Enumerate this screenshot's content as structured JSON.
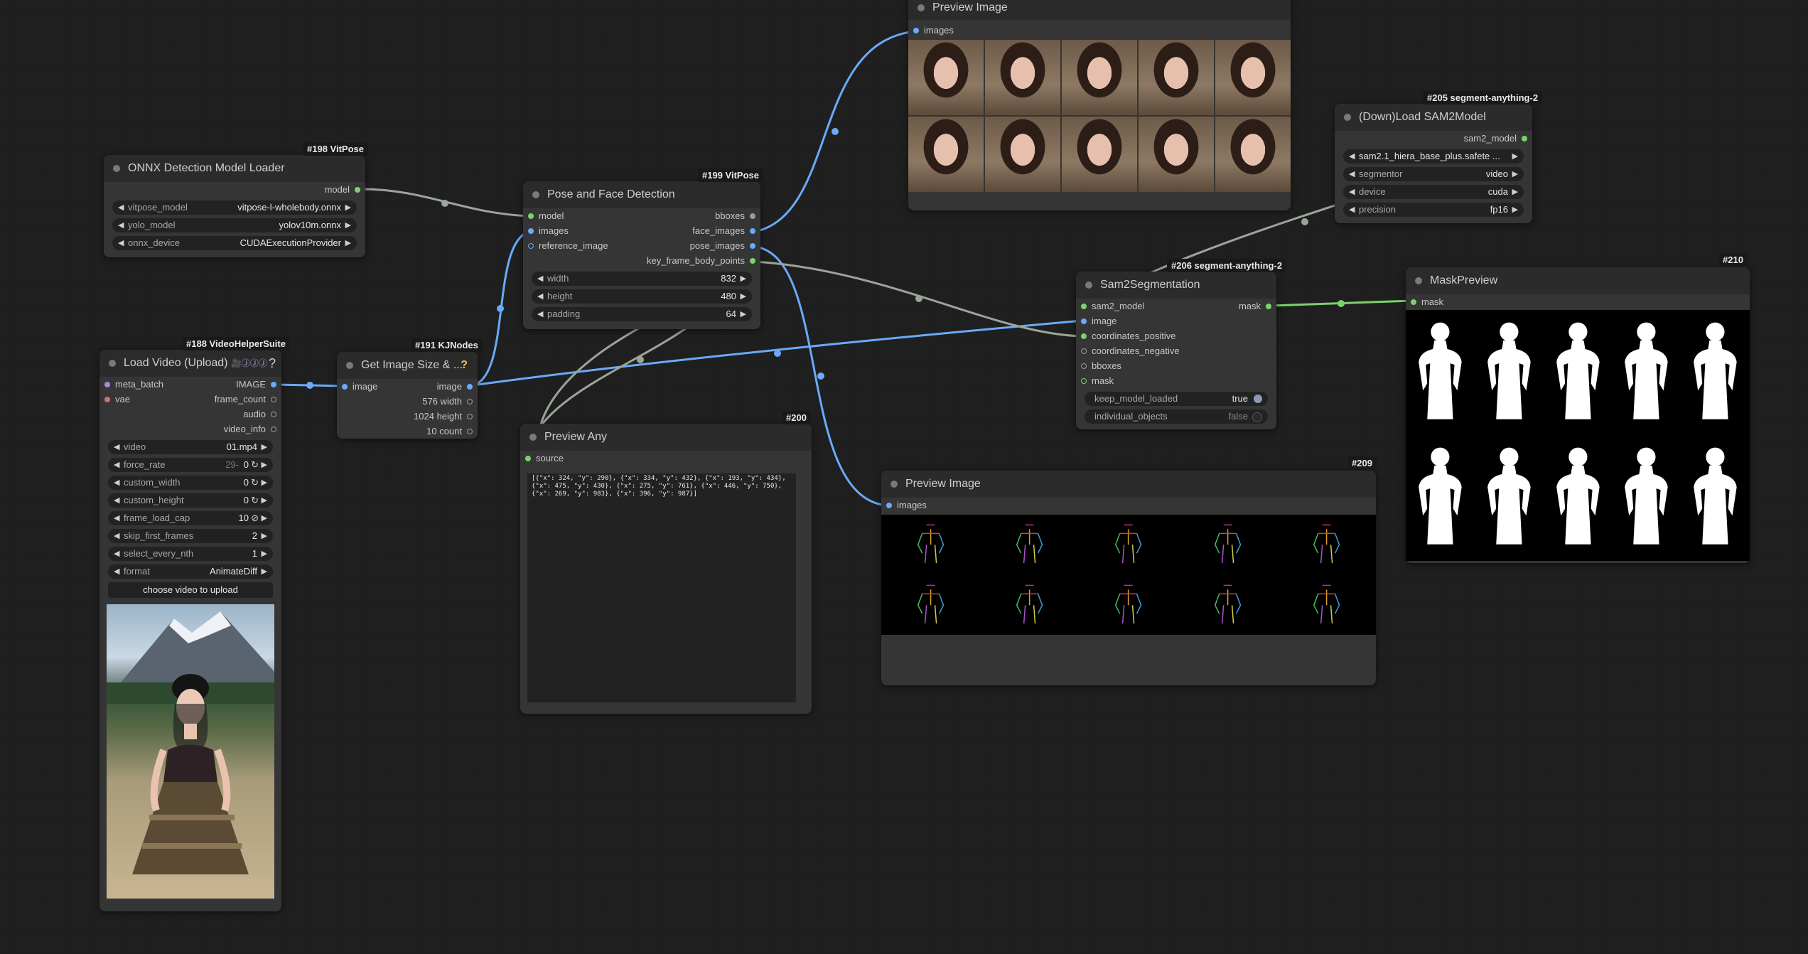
{
  "colors": {
    "canvas": "#1f1f1f",
    "node": "#353535",
    "title": "#2b2b2b",
    "image_link": "#6aaaf8",
    "model_link": "#9aa59a",
    "mask_link": "#7bd36b"
  },
  "nodes": {
    "onnx_loader": {
      "badge": "#198 VitPose",
      "title": "ONNX Detection Model Loader",
      "outputs": [
        "model"
      ],
      "widgets": [
        {
          "label": "vitpose_model",
          "value": "vitpose-l-wholebody.onnx"
        },
        {
          "label": "yolo_model",
          "value": "yolov10m.onnx"
        },
        {
          "label": "onnx_device",
          "value": "CUDAExecutionProvider"
        }
      ]
    },
    "pose_face": {
      "badge": "#199 VitPose",
      "title": "Pose and Face Detection",
      "inputs": [
        "model",
        "images",
        "reference_image"
      ],
      "outputs": [
        "bboxes",
        "face_images",
        "pose_images",
        "key_frame_body_points"
      ],
      "widgets": [
        {
          "label": "width",
          "value": "832"
        },
        {
          "label": "height",
          "value": "480"
        },
        {
          "label": "padding",
          "value": "64"
        }
      ]
    },
    "load_video": {
      "badge": "#188 VideoHelperSuite",
      "title": "Load Video (Upload)",
      "icons": "🎥ⒿⒿⒿ",
      "help": "?",
      "inputs": [
        "meta_batch",
        "vae"
      ],
      "outputs": [
        "IMAGE",
        "frame_count",
        "audio",
        "video_info"
      ],
      "widgets": [
        {
          "label": "video",
          "value": "01.mp4"
        },
        {
          "label": "force_rate",
          "value": "0",
          "hint": "29-"
        },
        {
          "label": "custom_width",
          "value": "0"
        },
        {
          "label": "custom_height",
          "value": "0"
        },
        {
          "label": "frame_load_cap",
          "value": "10"
        },
        {
          "label": "skip_first_frames",
          "value": "2"
        },
        {
          "label": "select_every_nth",
          "value": "1"
        },
        {
          "label": "format",
          "value": "AnimateDiff"
        }
      ],
      "button": "choose video to upload"
    },
    "get_size": {
      "badge": "#191 KJNodes",
      "title": "Get Image Size & ...",
      "help": "?",
      "inputs": [
        "image"
      ],
      "outputs": [
        "image",
        "576 width",
        "1024 height",
        "10 count"
      ]
    },
    "preview_faces": {
      "title": "Preview Image",
      "inputs": [
        "images"
      ]
    },
    "load_sam2": {
      "badge": "#205 segment-anything-2",
      "title": "(Down)Load SAM2Model",
      "outputs": [
        "sam2_model"
      ],
      "widgets": [
        {
          "label": "",
          "value": "sam2.1_hiera_base_plus.safete ..."
        },
        {
          "label": "segmentor",
          "value": "video"
        },
        {
          "label": "device",
          "value": "cuda"
        },
        {
          "label": "precision",
          "value": "fp16"
        }
      ]
    },
    "sam2seg": {
      "badge": "#206 segment-anything-2",
      "title": "Sam2Segmentation",
      "inputs": [
        "sam2_model",
        "image",
        "coordinates_positive",
        "coordinates_negative",
        "bboxes",
        "mask"
      ],
      "outputs": [
        "mask"
      ],
      "toggles": [
        {
          "label": "keep_model_loaded",
          "value": "true"
        },
        {
          "label": "individual_objects",
          "value": "false"
        }
      ]
    },
    "mask_preview": {
      "badge": "#210",
      "title": "MaskPreview",
      "inputs": [
        "mask"
      ]
    },
    "preview_any": {
      "badge": "#200",
      "title": "Preview Any",
      "inputs": [
        "source"
      ],
      "text": "[{\"x\": 324, \"y\": 290}, {\"x\": 334, \"y\": 432}, {\"x\": 193, \"y\": 434}, {\"x\": 475, \"y\": 430}, {\"x\": 275, \"y\": 761}, {\"x\": 446, \"y\": 750}, {\"x\": 269, \"y\": 983}, {\"x\": 396, \"y\": 987}]"
    },
    "preview_pose": {
      "badge": "#209",
      "title": "Preview Image",
      "inputs": [
        "images"
      ]
    }
  }
}
